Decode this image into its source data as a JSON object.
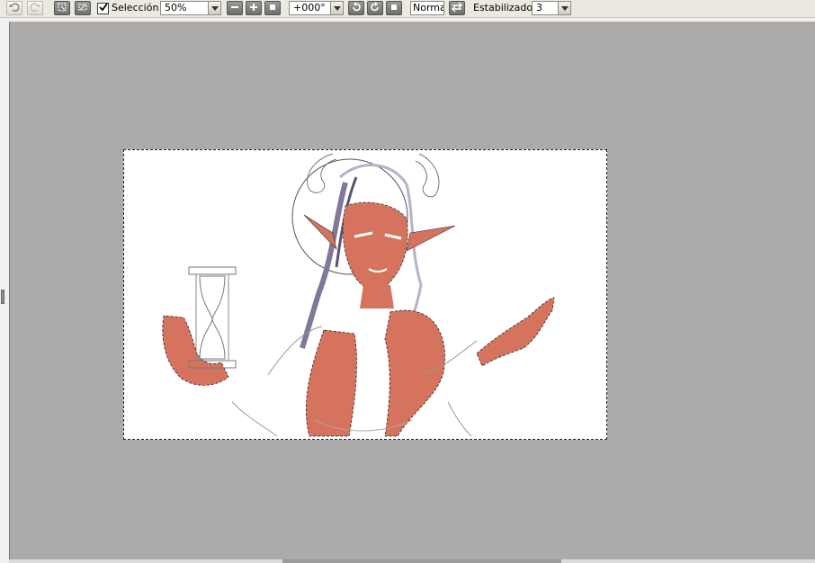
{
  "toolbar": {
    "undo_icon": "undo-icon",
    "redo_icon": "redo-icon",
    "selection_checkbox_checked": true,
    "selection_label": "Selección",
    "zoom_value": "50%",
    "rotation_value": "+000°",
    "blend_mode": "Normal",
    "stabilizer_label": "Estabilizador",
    "stabilizer_value": "3"
  },
  "colors": {
    "canvas_background": "#ababab",
    "document_background": "#ffffff",
    "skin": "#d5735e",
    "hair": "#7f7899"
  }
}
